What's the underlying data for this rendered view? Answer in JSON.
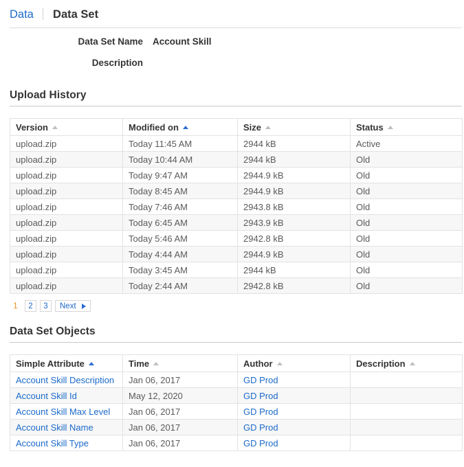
{
  "breadcrumb": {
    "parent_label": "Data",
    "current_label": "Data Set"
  },
  "detail": {
    "name_label": "Data Set Name",
    "name_value": "Account Skill",
    "description_label": "Description",
    "description_value": ""
  },
  "upload_history": {
    "title": "Upload History",
    "columns": [
      {
        "label": "Version",
        "sorted": false
      },
      {
        "label": "Modified on",
        "sorted": true
      },
      {
        "label": "Size",
        "sorted": false
      },
      {
        "label": "Status",
        "sorted": false
      }
    ],
    "rows": [
      {
        "version": "upload.zip",
        "modified": "Today 11:45 AM",
        "size": "2944 kB",
        "status": "Active"
      },
      {
        "version": "upload.zip",
        "modified": "Today 10:44 AM",
        "size": "2944 kB",
        "status": "Old"
      },
      {
        "version": "upload.zip",
        "modified": "Today 9:47 AM",
        "size": "2944.9 kB",
        "status": "Old"
      },
      {
        "version": "upload.zip",
        "modified": "Today 8:45 AM",
        "size": "2944.9 kB",
        "status": "Old"
      },
      {
        "version": "upload.zip",
        "modified": "Today 7:46 AM",
        "size": "2943.8 kB",
        "status": "Old"
      },
      {
        "version": "upload.zip",
        "modified": "Today 6:45 AM",
        "size": "2943.9 kB",
        "status": "Old"
      },
      {
        "version": "upload.zip",
        "modified": "Today 5:46 AM",
        "size": "2942.8 kB",
        "status": "Old"
      },
      {
        "version": "upload.zip",
        "modified": "Today 4:44 AM",
        "size": "2944.9 kB",
        "status": "Old"
      },
      {
        "version": "upload.zip",
        "modified": "Today 3:45 AM",
        "size": "2944 kB",
        "status": "Old"
      },
      {
        "version": "upload.zip",
        "modified": "Today 2:44 AM",
        "size": "2942.8 kB",
        "status": "Old"
      }
    ],
    "pagination": {
      "pages": [
        "1",
        "2",
        "3"
      ],
      "current_page": "1",
      "next_label": "Next"
    }
  },
  "data_set_objects": {
    "title": "Data Set Objects",
    "columns": [
      {
        "label": "Simple Attribute",
        "sorted": true
      },
      {
        "label": "Time",
        "sorted": false
      },
      {
        "label": "Author",
        "sorted": false
      },
      {
        "label": "Description",
        "sorted": false
      }
    ],
    "rows": [
      {
        "attribute": "Account Skill Description",
        "time": "Jan 06, 2017",
        "author": "GD Prod",
        "description": ""
      },
      {
        "attribute": "Account Skill Id",
        "time": "May 12, 2020",
        "author": "GD Prod",
        "description": ""
      },
      {
        "attribute": "Account Skill Max Level",
        "time": "Jan 06, 2017",
        "author": "GD Prod",
        "description": ""
      },
      {
        "attribute": "Account Skill Name",
        "time": "Jan 06, 2017",
        "author": "GD Prod",
        "description": ""
      },
      {
        "attribute": "Account Skill Type",
        "time": "Jan 06, 2017",
        "author": "GD Prod",
        "description": ""
      }
    ]
  },
  "colors": {
    "link": "#1b6ac9",
    "sort_active": "#2b6cd4",
    "sort_inactive": "#bdbdbd",
    "current_page": "#e98b1d",
    "text": "#333333",
    "cell_text": "#5a5a5a",
    "row_stripe": "#f7f7f7",
    "border": "#e2e2e2"
  }
}
